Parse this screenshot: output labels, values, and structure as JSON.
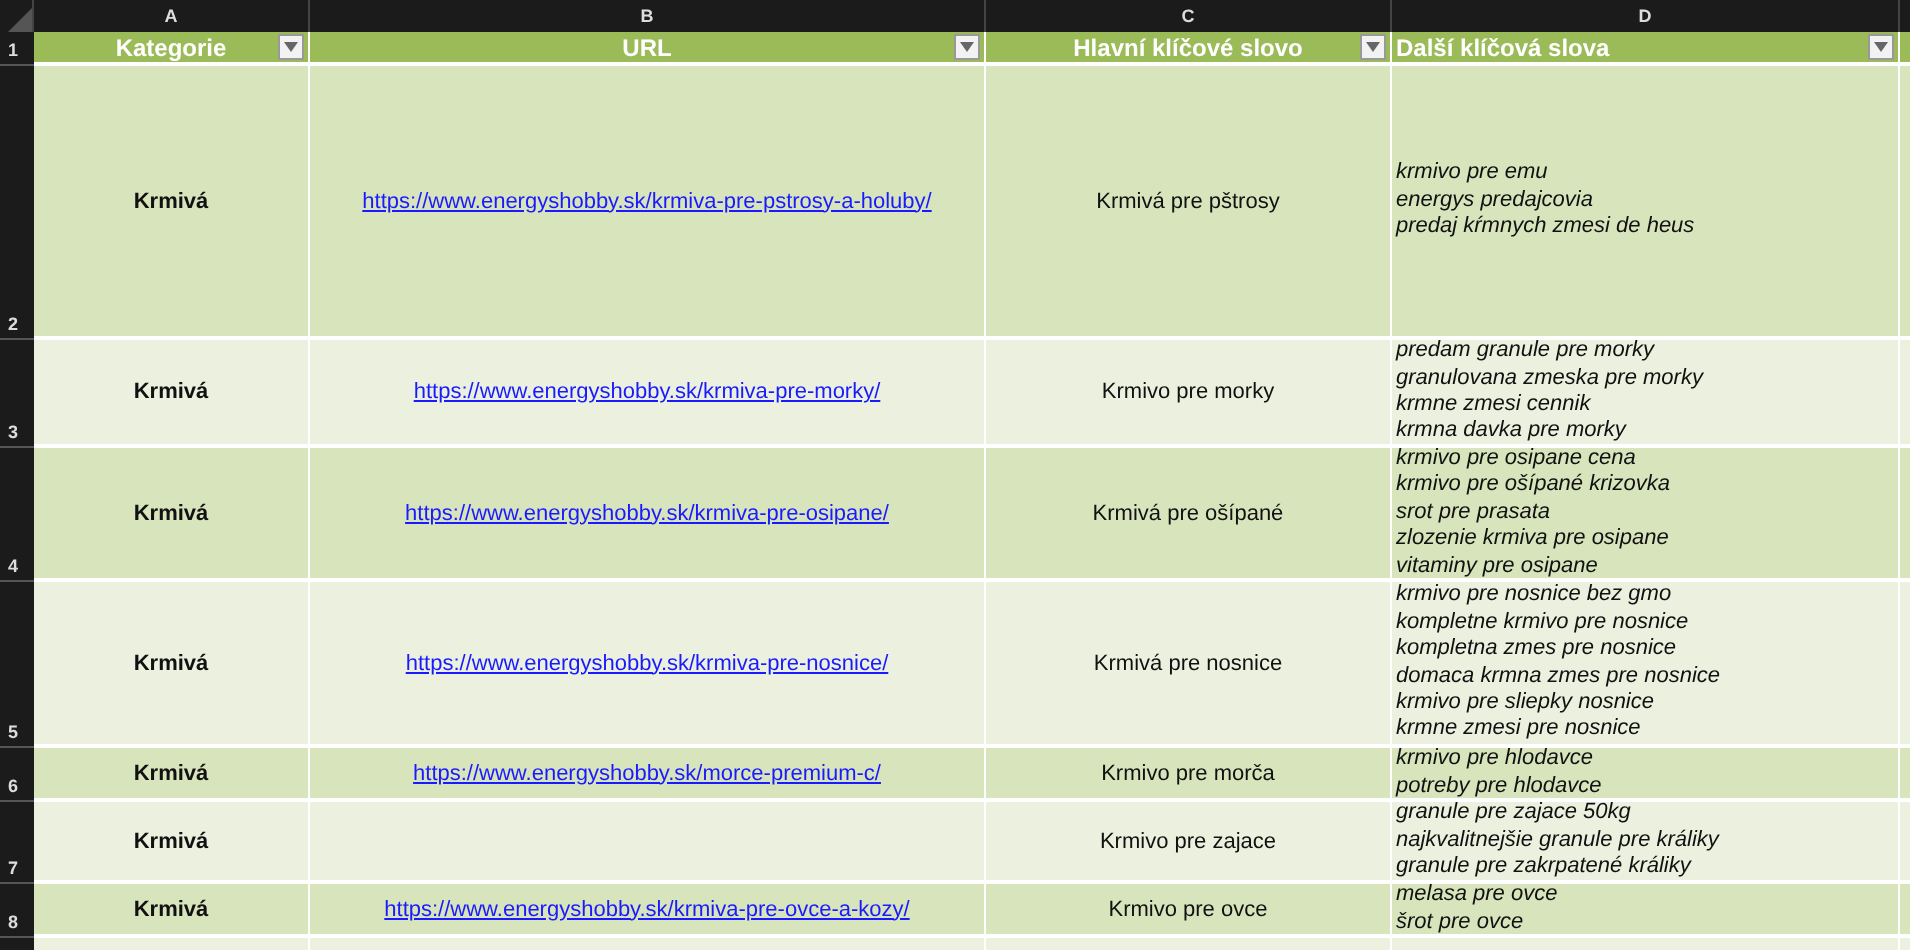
{
  "column_letters": [
    "A",
    "B",
    "C",
    "D"
  ],
  "header_row": {
    "row_number": "1",
    "cells": [
      "Kategorie",
      "URL",
      "Hlavní klíčové slovo",
      "Další klíčová slova"
    ]
  },
  "rows": [
    {
      "row_number": "2",
      "category": "Krmivá",
      "url": "https://www.energyshobby.sk/krmiva-pre-pstrosy-a-holuby/",
      "main_keyword": "Krmivá pre pštrosy",
      "keywords": [
        "krmivo pre emu",
        "energys predajcovia",
        "predaj kŕmnych zmesi de heus"
      ]
    },
    {
      "row_number": "3",
      "category": "Krmivá",
      "url": "https://www.energyshobby.sk/krmiva-pre-morky/",
      "main_keyword": "Krmivo pre morky",
      "keywords": [
        "predam granule pre morky",
        "granulovana zmeska pre morky",
        "krmne zmesi cennik",
        "krmna davka pre morky"
      ]
    },
    {
      "row_number": "4",
      "category": "Krmivá",
      "url": "https://www.energyshobby.sk/krmiva-pre-osipane/",
      "main_keyword": "Krmivá pre ošípané",
      "keywords": [
        "krmivo pre osipane cena",
        "krmivo pre ošípané krizovka",
        "srot pre prasata",
        "zlozenie krmiva pre osipane",
        "vitaminy pre osipane"
      ]
    },
    {
      "row_number": "5",
      "category": "Krmivá",
      "url": "https://www.energyshobby.sk/krmiva-pre-nosnice/",
      "main_keyword": "Krmivá pre nosnice",
      "keywords": [
        "krmivo pre nosnice bez gmo",
        "kompletne krmivo pre nosnice",
        "kompletna zmes pre nosnice",
        "domaca krmna zmes pre nosnice",
        "krmivo pre sliepky nosnice",
        "krmne zmesi pre nosnice"
      ]
    },
    {
      "row_number": "6",
      "category": "Krmivá",
      "url": "https://www.energyshobby.sk/morce-premium-c/",
      "main_keyword": "Krmivo pre morča",
      "keywords": [
        "krmivo pre hlodavce",
        "potreby pre hlodavce"
      ]
    },
    {
      "row_number": "7",
      "category": "Krmivá",
      "main_keyword": "Krmivo pre zajace",
      "keywords": [
        "granule pre zajace 50kg",
        "najkvalitnejšie granule pre králiky",
        "granule pre zakrpatené králiky"
      ]
    },
    {
      "row_number": "8",
      "category": "Krmivá",
      "url": "https://www.energyshobby.sk/krmiva-pre-ovce-a-kozy/",
      "main_keyword": "Krmivo pre ovce",
      "keywords": [
        "melasa pre ovce",
        "šrot pre ovce"
      ]
    }
  ]
}
